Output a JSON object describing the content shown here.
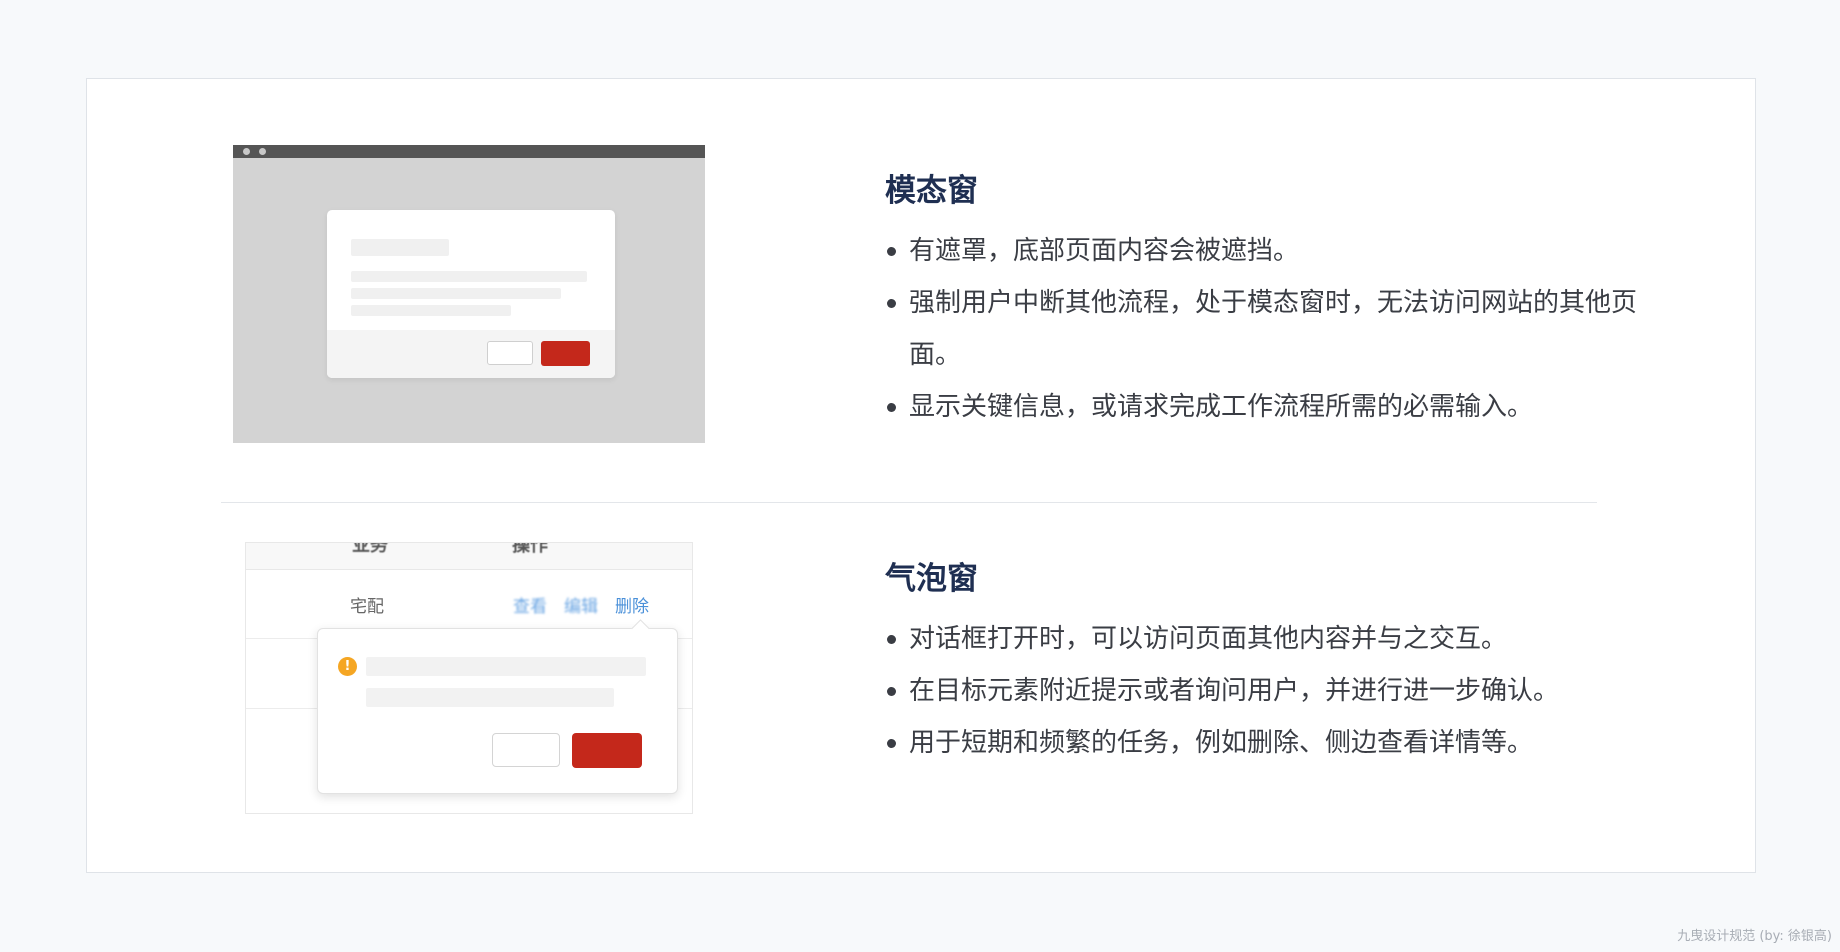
{
  "sections": [
    {
      "title": "模态窗",
      "bullets": [
        "有遮罩，底部页面内容会被遮挡。",
        "强制用户中断其他流程，处于模态窗时，无法访问网站的其他页面。",
        "显示关键信息，或请求完成工作流程所需的必需输入。"
      ]
    },
    {
      "title": "气泡窗",
      "bullets": [
        "对话框打开时，可以访问页面其他内容并与之交互。",
        "在目标元素附近提示或者询问用户，并进行进一步确认。",
        "用于短期和频繁的任务，例如删除、侧边查看详情等。"
      ]
    }
  ],
  "popover_illustration": {
    "header_cells": [
      "业务",
      "操作"
    ],
    "row_label": "宅配",
    "actions": [
      "查看",
      "编辑",
      "删除"
    ],
    "warning_symbol": "!"
  },
  "colors": {
    "primary_red": "#c4281b",
    "title_navy": "#1f2f52",
    "link_blue": "#4a90d9",
    "warning_orange": "#f5a623"
  },
  "watermark": "九曳设计规范 (by: 徐银高)"
}
